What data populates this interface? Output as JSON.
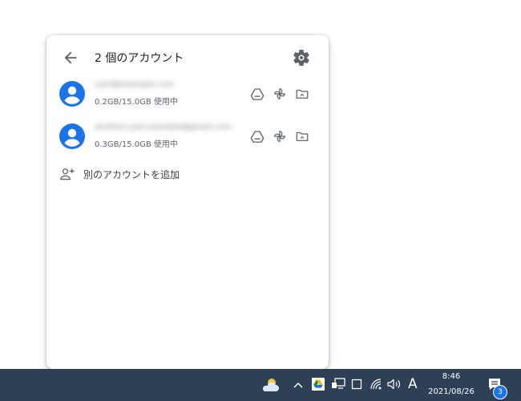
{
  "panel": {
    "header": {
      "back_icon": "arrow-left-icon",
      "title": "2 個のアカウント",
      "settings_icon": "gear-icon"
    },
    "accounts": [
      {
        "email": "user@example.com",
        "usage": "0.2GB/15.0GB 使用中",
        "avatar_color": "#1a73e8",
        "actions": [
          "google-drive-icon",
          "google-photos-icon",
          "folder-icon"
        ]
      },
      {
        "email": "another.user.example@gmail.com",
        "usage": "0.3GB/15.0GB 使用中",
        "avatar_color": "#1a73e8",
        "actions": [
          "google-drive-icon",
          "google-photos-icon",
          "folder-icon"
        ]
      }
    ],
    "add_account": {
      "icon": "add-person-icon",
      "label": "別のアカウントを追加"
    }
  },
  "taskbar": {
    "background": "#2e4056",
    "weather_icon": "cloud-sun-icon",
    "overflow_icon": "chevron-up-icon",
    "tray_icons": [
      "google-drive-icon",
      "network-device-icon",
      "window-icon",
      "wifi-icon",
      "volume-icon"
    ],
    "ime_indicator": "A",
    "clock": {
      "time": "8:46",
      "date": "2021/08/26"
    },
    "notifications": {
      "icon": "action-center-icon",
      "count": "3"
    }
  }
}
